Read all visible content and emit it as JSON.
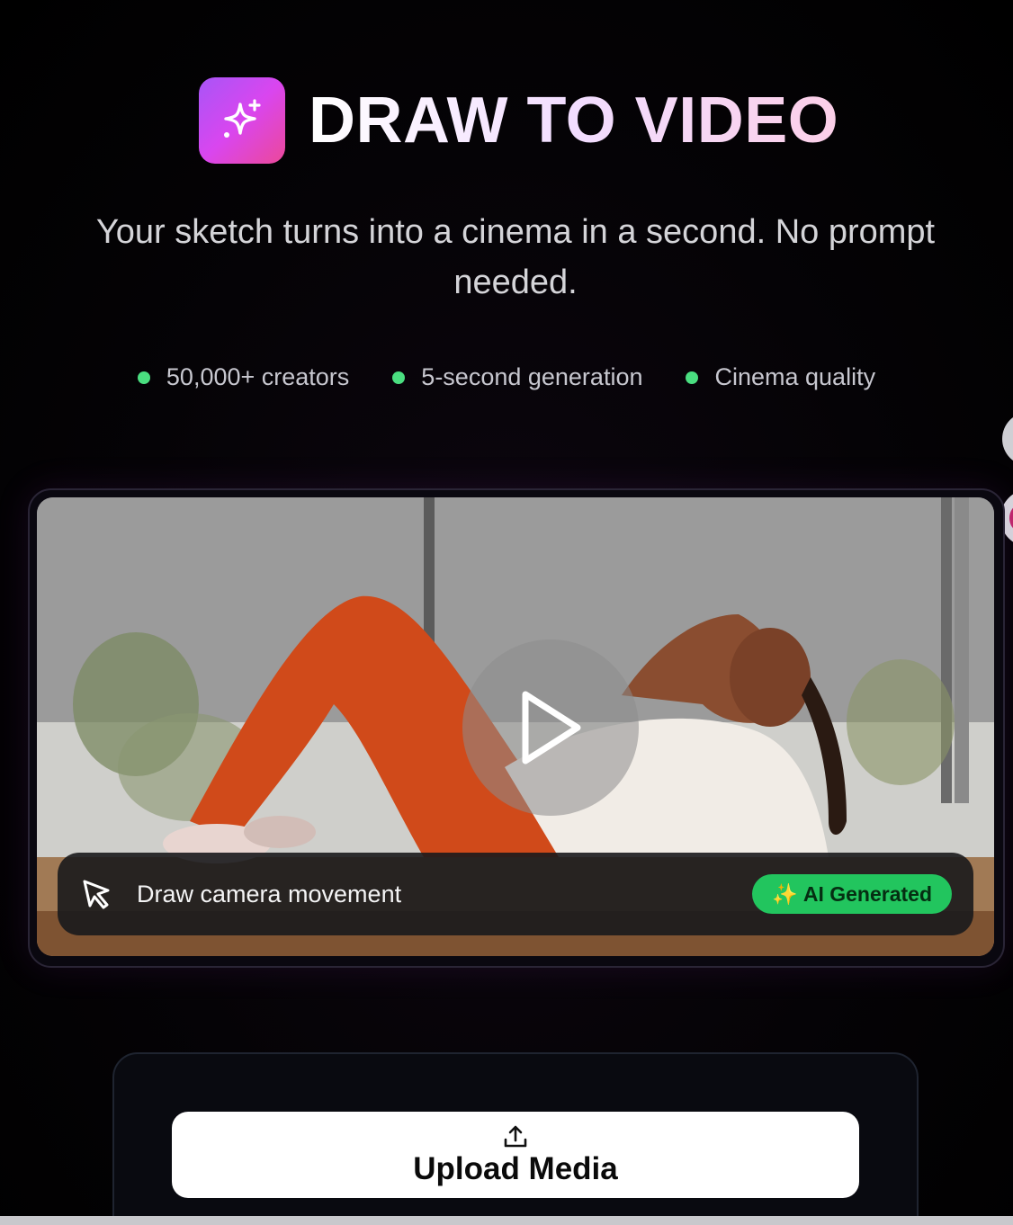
{
  "header": {
    "title": "DRAW TO VIDEO",
    "logo_icon": "sparkles-icon",
    "subtitle": "Your sketch turns into a cinema in a second. No prompt needed."
  },
  "features": [
    {
      "label": "50,000+ creators"
    },
    {
      "label": "5-second generation"
    },
    {
      "label": "Cinema quality"
    }
  ],
  "video": {
    "play_icon": "play-icon",
    "caption": "Draw camera movement",
    "caption_icon": "cursor-icon",
    "badge": "AI Generated",
    "badge_emoji": "✨"
  },
  "upload": {
    "button_label": "Upload Media",
    "icon": "upload-icon"
  },
  "colors": {
    "accent_gradient_start": "#a855f7",
    "accent_gradient_end": "#ec4899",
    "status_dot": "#4ade80",
    "badge_bg": "#22c55e"
  }
}
